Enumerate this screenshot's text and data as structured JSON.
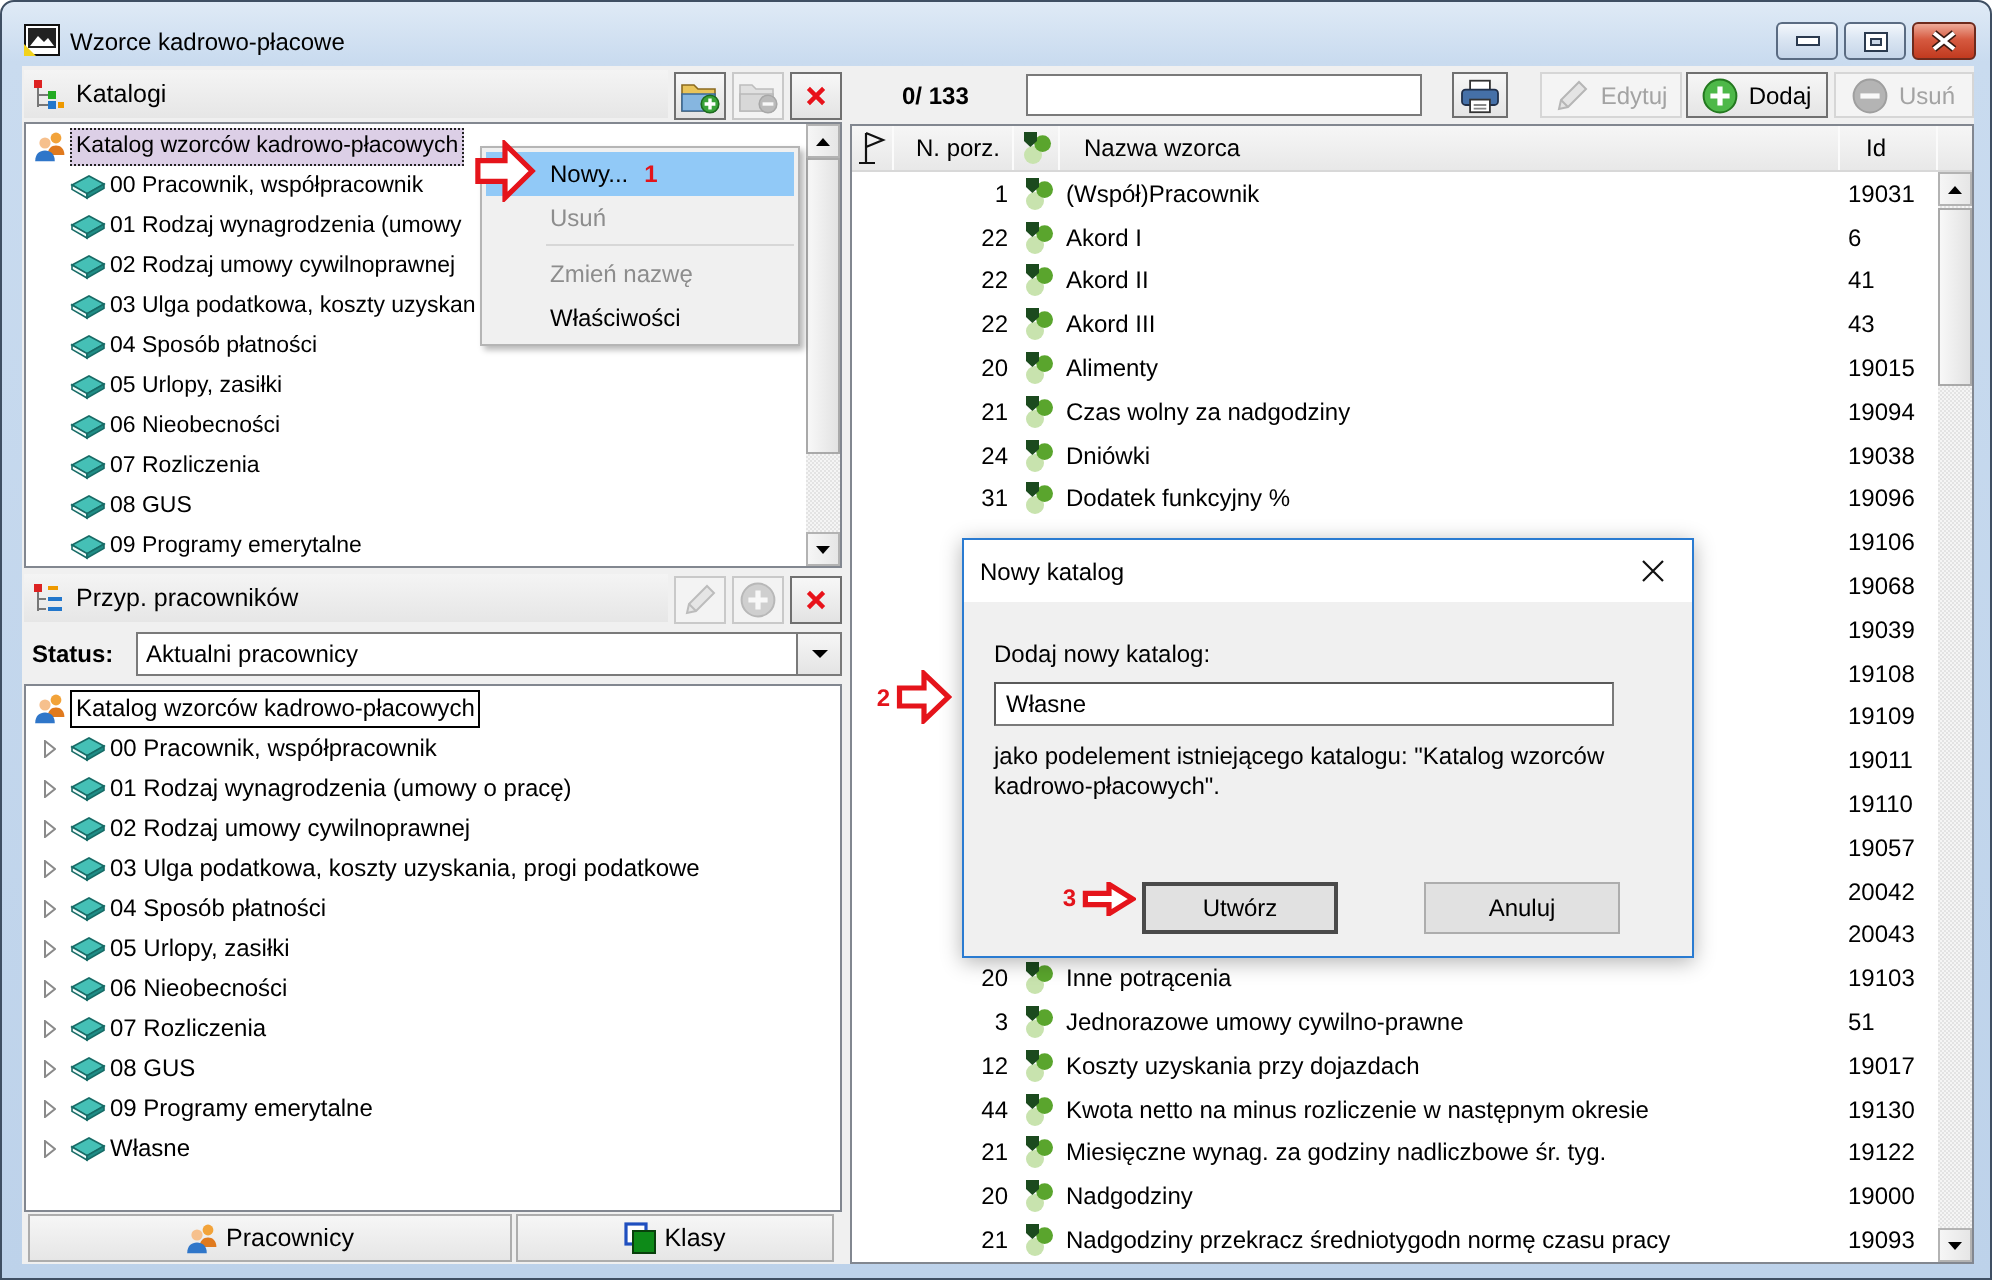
{
  "window": {
    "title": "Wzorce kadrowo-płacowe"
  },
  "catalog_panel": {
    "title": "Katalogi",
    "toolbar": [
      {
        "kind": "folder-add",
        "disabled": false
      },
      {
        "kind": "folder-remove",
        "disabled": true
      },
      {
        "kind": "delete",
        "disabled": false
      }
    ],
    "tree": {
      "focused": true,
      "items": [
        {
          "label": "Katalog wzorców kadrowo-płacowych",
          "selected": true,
          "children": [
            {
              "label": "00 Pracownik, współpracownik",
              "selected": false
            },
            {
              "label": "01 Rodzaj wynagrodzenia (umowy",
              "selected": false
            },
            {
              "label": "02 Rodzaj umowy cywilnoprawnej",
              "selected": false
            },
            {
              "label": "03 Ulga podatkowa, koszty uzyskan",
              "selected": false
            },
            {
              "label": "04 Sposób płatności",
              "selected": false
            },
            {
              "label": "05 Urlopy, zasiłki",
              "selected": false
            },
            {
              "label": "06 Nieobecności",
              "selected": false
            },
            {
              "label": "07 Rozliczenia",
              "selected": false
            },
            {
              "label": "08 GUS",
              "selected": false
            },
            {
              "label": "09 Programy emerytalne",
              "selected": false
            }
          ]
        }
      ]
    },
    "context_menu": {
      "items": [
        {
          "kind": "item",
          "label": "Nowy...",
          "selected": true,
          "disabled": false,
          "annotation": "1"
        },
        {
          "kind": "item",
          "label": "Usuń",
          "selected": false,
          "disabled": true
        },
        {
          "kind": "separator"
        },
        {
          "kind": "item",
          "label": "Zmień nazwę",
          "selected": false,
          "disabled": true
        },
        {
          "kind": "item",
          "label": "Właściwości",
          "selected": false,
          "disabled": false
        }
      ]
    }
  },
  "assignment_panel": {
    "title": "Przyp. pracowników",
    "toolbar": [
      {
        "kind": "edit",
        "disabled": true
      },
      {
        "kind": "add",
        "disabled": true
      },
      {
        "kind": "delete",
        "disabled": false
      }
    ],
    "status": {
      "label": "Status:",
      "value": "Aktualni pracownicy"
    },
    "tree": {
      "focused": false,
      "items": [
        {
          "label": "Katalog wzorców kadrowo-płacowych",
          "selected": true,
          "children": [
            {
              "label": "00 Pracownik, współpracownik",
              "selected": false,
              "expanded": false
            },
            {
              "label": "01 Rodzaj wynagrodzenia (umowy o pracę)",
              "selected": false,
              "expanded": false
            },
            {
              "label": "02 Rodzaj umowy cywilnoprawnej",
              "selected": false,
              "expanded": false
            },
            {
              "label": "03 Ulga podatkowa, koszty uzyskania, progi podatkowe",
              "selected": false,
              "expanded": false
            },
            {
              "label": "04 Sposób płatności",
              "selected": false,
              "expanded": false
            },
            {
              "label": "05 Urlopy, zasiłki",
              "selected": false,
              "expanded": false
            },
            {
              "label": "06 Nieobecności",
              "selected": false,
              "expanded": false
            },
            {
              "label": "07 Rozliczenia",
              "selected": false,
              "expanded": false
            },
            {
              "label": "08 GUS",
              "selected": false,
              "expanded": false
            },
            {
              "label": "09 Programy emerytalne",
              "selected": false,
              "expanded": false
            },
            {
              "label": "Własne",
              "selected": false,
              "expanded": false
            }
          ]
        }
      ]
    },
    "buttons": [
      {
        "kind": "employees",
        "label": "Pracownicy"
      },
      {
        "kind": "classes",
        "label": "Klasy"
      }
    ]
  },
  "templates": {
    "count": "0/ 133",
    "toolbar": [
      {
        "kind": "print",
        "disabled": false
      },
      {
        "kind": "edit",
        "label": "Edytuj",
        "disabled": true
      },
      {
        "kind": "add",
        "label": "Dodaj",
        "disabled": false
      },
      {
        "kind": "remove",
        "label": "Usuń",
        "disabled": true
      }
    ],
    "table": {
      "columns": [
        {
          "kind": "flag"
        },
        {
          "kind": "number",
          "label": "N. porz."
        },
        {
          "kind": "type"
        },
        {
          "kind": "name",
          "label": "Nazwa wzorca"
        },
        {
          "kind": "id",
          "label": "Id"
        }
      ],
      "rows": [
        {
          "number": "1",
          "name": "(Współ)Pracownik",
          "id": "19031",
          "selected": false
        },
        {
          "number": "22",
          "name": "Akord I",
          "id": "6",
          "selected": false
        },
        {
          "number": "22",
          "name": "Akord II",
          "id": "41",
          "selected": false
        },
        {
          "number": "22",
          "name": "Akord III",
          "id": "43",
          "selected": false
        },
        {
          "number": "20",
          "name": "Alimenty",
          "id": "19015",
          "selected": false
        },
        {
          "number": "21",
          "name": "Czas wolny za nadgodziny",
          "id": "19094",
          "selected": false
        },
        {
          "number": "24",
          "name": "Dniówki",
          "id": "19038",
          "selected": false
        },
        {
          "number": "31",
          "name": "Dodatek funkcyjny %",
          "id": "19096",
          "selected": false
        },
        {
          "id": "19106",
          "selected": false
        },
        {
          "id": "19068",
          "selected": false
        },
        {
          "id": "19039",
          "selected": false
        },
        {
          "id": "19108",
          "selected": false
        },
        {
          "id": "19109",
          "selected": false
        },
        {
          "id": "19011",
          "selected": false
        },
        {
          "id": "19110",
          "selected": false
        },
        {
          "id": "19057",
          "selected": false
        },
        {
          "id": "20042",
          "selected": false
        },
        {
          "id": "20043",
          "selected": false
        },
        {
          "number": "20",
          "name": "Inne potrącenia",
          "id": "19103",
          "selected": false
        },
        {
          "number": "3",
          "name": "Jednorazowe umowy cywilno-prawne",
          "id": "51",
          "selected": false
        },
        {
          "number": "12",
          "name": "Koszty uzyskania przy dojazdach",
          "id": "19017",
          "selected": false
        },
        {
          "number": "44",
          "name": "Kwota netto na minus rozliczenie w następnym okresie",
          "id": "19130",
          "selected": false
        },
        {
          "number": "21",
          "name": "Miesięczne wynag. za godziny nadliczbowe śr. tyg.",
          "id": "19122",
          "selected": false
        },
        {
          "number": "20",
          "name": "Nadgodziny",
          "id": "19000",
          "selected": false
        },
        {
          "number": "21",
          "name": "Nadgodziny przekracz średniotygodn normę czasu pracy",
          "id": "19093",
          "selected": false
        }
      ]
    }
  },
  "dialog": {
    "title": "Nowy katalog",
    "prompt": "Dodaj nowy katalog:",
    "input": {
      "value": "Własne",
      "annotation": "2"
    },
    "note": "jako podelement istniejącego katalogu: \"Katalog wzorców kadrowo-płacowych\".",
    "buttons": [
      {
        "label": "Utwórz",
        "default": true,
        "annotation": "3"
      },
      {
        "label": "Anuluj",
        "default": false
      }
    ]
  }
}
